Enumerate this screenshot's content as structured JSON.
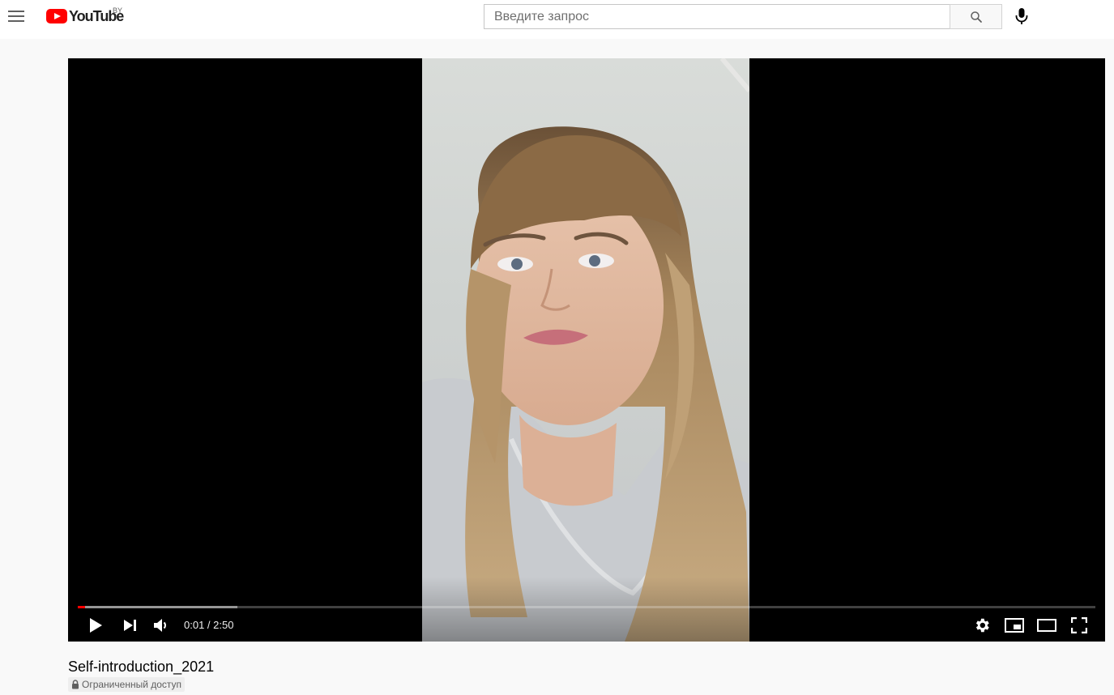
{
  "header": {
    "logo_text": "YouTube",
    "country_code": "BY",
    "search_placeholder": "Введите запрос"
  },
  "player": {
    "current_time": "0:01",
    "duration": "2:50",
    "time_display": "0:01 / 2:50",
    "progress_played_fraction": 0.007,
    "progress_loaded_fraction": 0.157
  },
  "video": {
    "title": "Self-introduction_2021",
    "privacy_badge": "Ограниченный доступ"
  },
  "colors": {
    "brand_red": "#ff0000",
    "page_background": "#f9f9f9"
  },
  "icons": {
    "menu": "menu-icon",
    "search": "search-icon",
    "mic": "mic-icon",
    "play": "play-icon",
    "next": "next-icon",
    "volume": "volume-icon",
    "settings": "gear-icon",
    "miniplayer": "miniplayer-icon",
    "theater": "theater-mode-icon",
    "fullscreen": "fullscreen-icon",
    "lock": "lock-icon"
  }
}
